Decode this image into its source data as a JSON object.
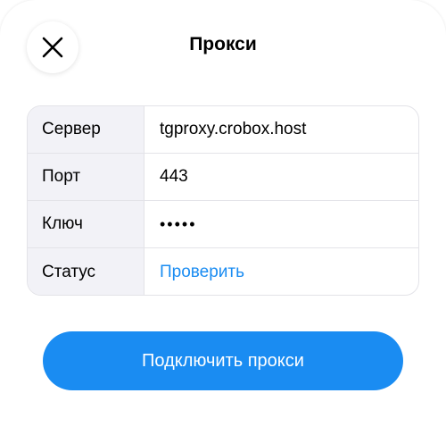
{
  "header": {
    "title": "Прокси",
    "close_icon": "close-icon"
  },
  "fields": [
    {
      "label": "Сервер",
      "value": "tgproxy.crobox.host"
    },
    {
      "label": "Порт",
      "value": "443"
    },
    {
      "label": "Ключ",
      "value": "•••••"
    },
    {
      "label": "Статус",
      "value": "Проверить"
    }
  ],
  "connect_button": {
    "label": "Подключить прокси"
  },
  "colors": {
    "accent": "#1a8cf2",
    "label_background": "#f2f2f7",
    "border": "#e3e3e8"
  }
}
